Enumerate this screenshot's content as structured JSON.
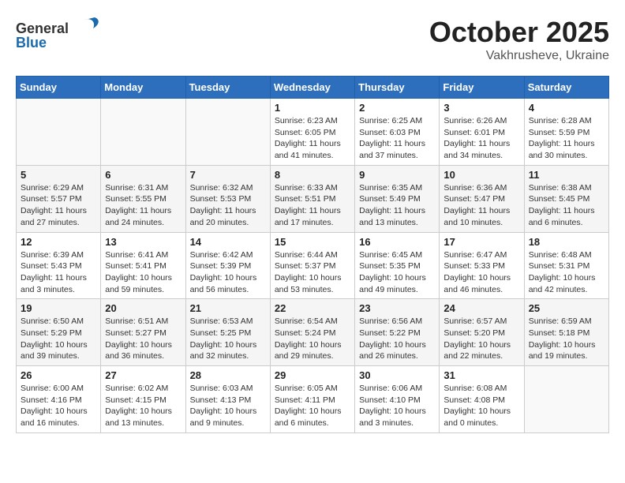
{
  "logo": {
    "text_general": "General",
    "text_blue": "Blue"
  },
  "header": {
    "month": "October 2025",
    "location": "Vakhrusheve, Ukraine"
  },
  "days_of_week": [
    "Sunday",
    "Monday",
    "Tuesday",
    "Wednesday",
    "Thursday",
    "Friday",
    "Saturday"
  ],
  "weeks": [
    [
      {
        "day": "",
        "info": ""
      },
      {
        "day": "",
        "info": ""
      },
      {
        "day": "",
        "info": ""
      },
      {
        "day": "1",
        "info": "Sunrise: 6:23 AM\nSunset: 6:05 PM\nDaylight: 11 hours\nand 41 minutes."
      },
      {
        "day": "2",
        "info": "Sunrise: 6:25 AM\nSunset: 6:03 PM\nDaylight: 11 hours\nand 37 minutes."
      },
      {
        "day": "3",
        "info": "Sunrise: 6:26 AM\nSunset: 6:01 PM\nDaylight: 11 hours\nand 34 minutes."
      },
      {
        "day": "4",
        "info": "Sunrise: 6:28 AM\nSunset: 5:59 PM\nDaylight: 11 hours\nand 30 minutes."
      }
    ],
    [
      {
        "day": "5",
        "info": "Sunrise: 6:29 AM\nSunset: 5:57 PM\nDaylight: 11 hours\nand 27 minutes."
      },
      {
        "day": "6",
        "info": "Sunrise: 6:31 AM\nSunset: 5:55 PM\nDaylight: 11 hours\nand 24 minutes."
      },
      {
        "day": "7",
        "info": "Sunrise: 6:32 AM\nSunset: 5:53 PM\nDaylight: 11 hours\nand 20 minutes."
      },
      {
        "day": "8",
        "info": "Sunrise: 6:33 AM\nSunset: 5:51 PM\nDaylight: 11 hours\nand 17 minutes."
      },
      {
        "day": "9",
        "info": "Sunrise: 6:35 AM\nSunset: 5:49 PM\nDaylight: 11 hours\nand 13 minutes."
      },
      {
        "day": "10",
        "info": "Sunrise: 6:36 AM\nSunset: 5:47 PM\nDaylight: 11 hours\nand 10 minutes."
      },
      {
        "day": "11",
        "info": "Sunrise: 6:38 AM\nSunset: 5:45 PM\nDaylight: 11 hours\nand 6 minutes."
      }
    ],
    [
      {
        "day": "12",
        "info": "Sunrise: 6:39 AM\nSunset: 5:43 PM\nDaylight: 11 hours\nand 3 minutes."
      },
      {
        "day": "13",
        "info": "Sunrise: 6:41 AM\nSunset: 5:41 PM\nDaylight: 10 hours\nand 59 minutes."
      },
      {
        "day": "14",
        "info": "Sunrise: 6:42 AM\nSunset: 5:39 PM\nDaylight: 10 hours\nand 56 minutes."
      },
      {
        "day": "15",
        "info": "Sunrise: 6:44 AM\nSunset: 5:37 PM\nDaylight: 10 hours\nand 53 minutes."
      },
      {
        "day": "16",
        "info": "Sunrise: 6:45 AM\nSunset: 5:35 PM\nDaylight: 10 hours\nand 49 minutes."
      },
      {
        "day": "17",
        "info": "Sunrise: 6:47 AM\nSunset: 5:33 PM\nDaylight: 10 hours\nand 46 minutes."
      },
      {
        "day": "18",
        "info": "Sunrise: 6:48 AM\nSunset: 5:31 PM\nDaylight: 10 hours\nand 42 minutes."
      }
    ],
    [
      {
        "day": "19",
        "info": "Sunrise: 6:50 AM\nSunset: 5:29 PM\nDaylight: 10 hours\nand 39 minutes."
      },
      {
        "day": "20",
        "info": "Sunrise: 6:51 AM\nSunset: 5:27 PM\nDaylight: 10 hours\nand 36 minutes."
      },
      {
        "day": "21",
        "info": "Sunrise: 6:53 AM\nSunset: 5:25 PM\nDaylight: 10 hours\nand 32 minutes."
      },
      {
        "day": "22",
        "info": "Sunrise: 6:54 AM\nSunset: 5:24 PM\nDaylight: 10 hours\nand 29 minutes."
      },
      {
        "day": "23",
        "info": "Sunrise: 6:56 AM\nSunset: 5:22 PM\nDaylight: 10 hours\nand 26 minutes."
      },
      {
        "day": "24",
        "info": "Sunrise: 6:57 AM\nSunset: 5:20 PM\nDaylight: 10 hours\nand 22 minutes."
      },
      {
        "day": "25",
        "info": "Sunrise: 6:59 AM\nSunset: 5:18 PM\nDaylight: 10 hours\nand 19 minutes."
      }
    ],
    [
      {
        "day": "26",
        "info": "Sunrise: 6:00 AM\nSunset: 4:16 PM\nDaylight: 10 hours\nand 16 minutes."
      },
      {
        "day": "27",
        "info": "Sunrise: 6:02 AM\nSunset: 4:15 PM\nDaylight: 10 hours\nand 13 minutes."
      },
      {
        "day": "28",
        "info": "Sunrise: 6:03 AM\nSunset: 4:13 PM\nDaylight: 10 hours\nand 9 minutes."
      },
      {
        "day": "29",
        "info": "Sunrise: 6:05 AM\nSunset: 4:11 PM\nDaylight: 10 hours\nand 6 minutes."
      },
      {
        "day": "30",
        "info": "Sunrise: 6:06 AM\nSunset: 4:10 PM\nDaylight: 10 hours\nand 3 minutes."
      },
      {
        "day": "31",
        "info": "Sunrise: 6:08 AM\nSunset: 4:08 PM\nDaylight: 10 hours\nand 0 minutes."
      },
      {
        "day": "",
        "info": ""
      }
    ]
  ]
}
